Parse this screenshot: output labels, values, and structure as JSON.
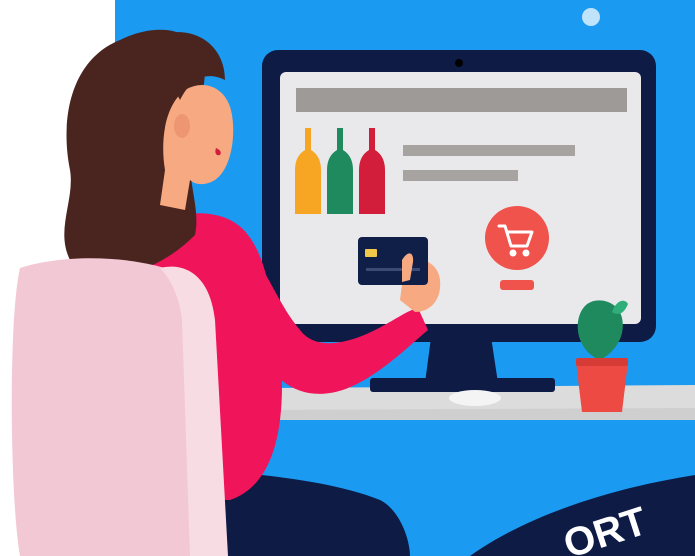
{
  "scene": {
    "description_label": "online-shopping-illustration",
    "badge": {
      "text": "ORT"
    }
  },
  "colors": {
    "background_blue": "#1A9AF0",
    "monitor_frame": "#0D1B45",
    "screen": "#E9E9EC",
    "header_bar": "#9E9A98",
    "text_line": "#A7A3A1",
    "bottle_orange": "#F6A623",
    "bottle_green": "#1E8A5E",
    "bottle_red": "#D21E3A",
    "cart_circle": "#F0524C",
    "card": "#0F1F48",
    "card_chip": "#F2C84B",
    "sweater": "#F0145A",
    "skin": "#F7A981",
    "hair": "#4A2520",
    "chair": "#F2C8D4",
    "desk": "#DCDCDC",
    "plant": "#1E8A5E",
    "pot": "#EE4A44",
    "pants": "#0D1B45"
  },
  "icons": [
    "cart-icon",
    "credit-card-icon",
    "wine-bottle-icon",
    "plant-icon",
    "webcam-icon"
  ]
}
